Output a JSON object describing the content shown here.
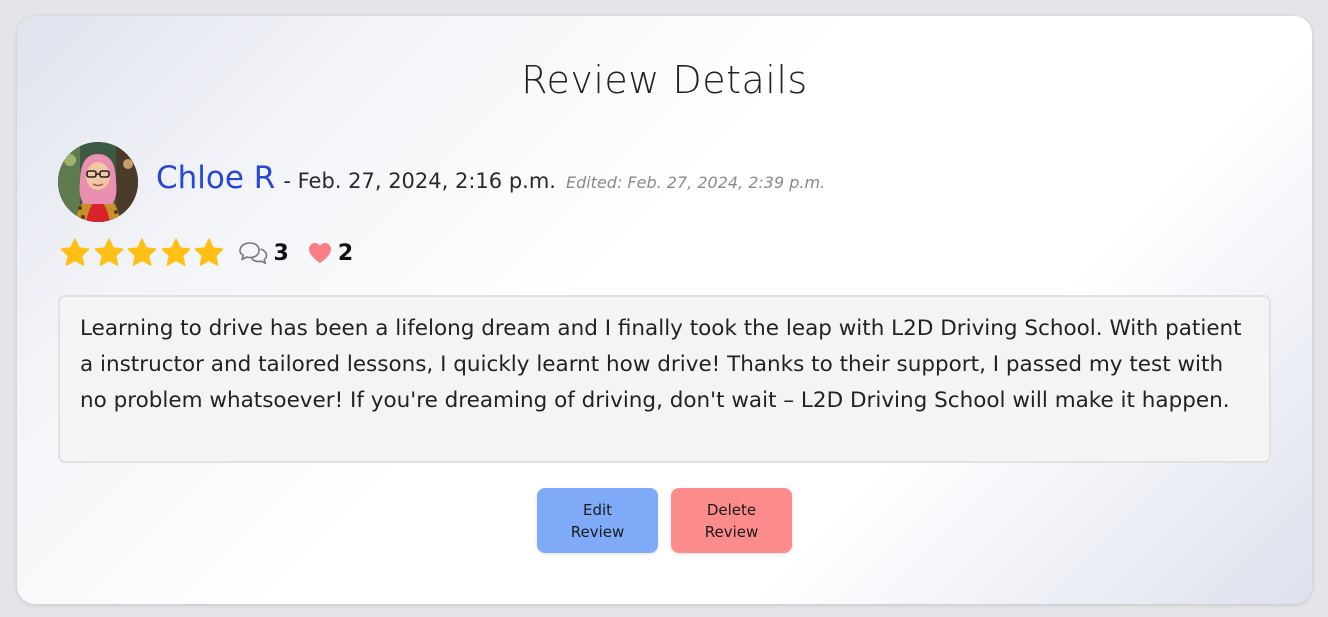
{
  "page": {
    "title": "Review Details"
  },
  "review": {
    "author": "Chloe R",
    "date": "- Feb. 27, 2024, 2:16 p.m.",
    "edited": "Edited: Feb. 27, 2024, 2:39 p.m.",
    "rating": 5,
    "rating_max": 5,
    "comments_count": "3",
    "likes_count": "2",
    "body": "Learning to drive has been a lifelong dream and I finally took the leap with L2D Driving School. With patient a instructor and tailored lessons, I quickly learnt how drive! Thanks to their support, I passed my test with no problem whatsoever! If you're dreaming of driving, don't wait – L2D Driving School will make it happen."
  },
  "actions": {
    "edit_label": "Edit Review",
    "delete_label": "Delete Review"
  },
  "icons": {
    "star": "star-icon",
    "comments": "comments-icon",
    "likes": "heart-icon"
  },
  "colors": {
    "author_link": "#2847d6",
    "star": "#ffbf14",
    "heart": "#fb7d86",
    "edit_button": "#7eaaf8",
    "delete_button": "#fc8b8c"
  }
}
